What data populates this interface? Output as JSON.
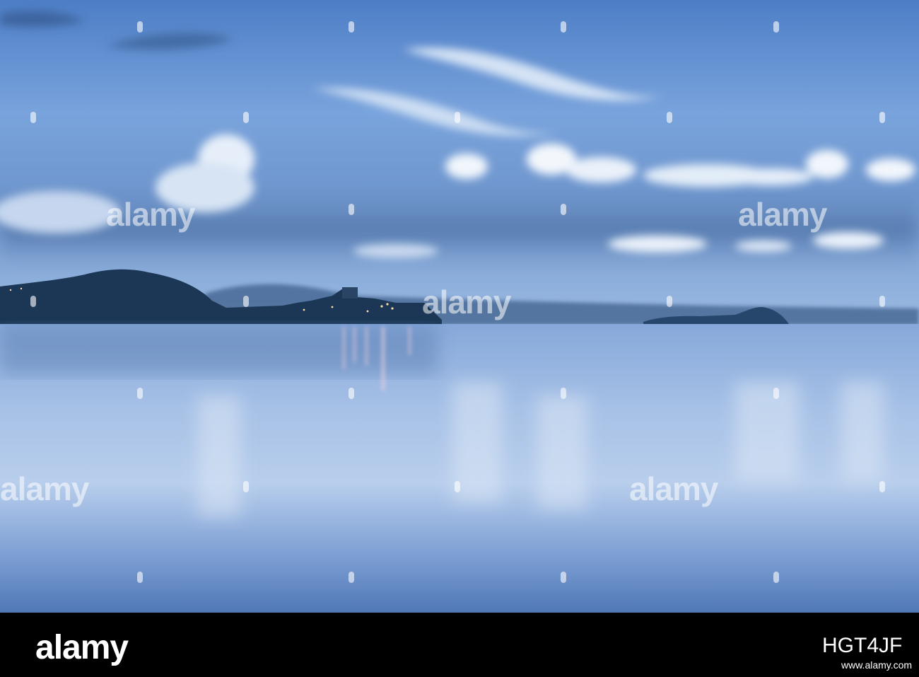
{
  "photo": {
    "subject": "lake-at-dusk",
    "colors": {
      "sky_top": "#4f7fc4",
      "sky_mid": "#8fb3e0",
      "cloud_band": "#5a7fb2",
      "hill_dark": "#1c3756",
      "water_top": "#7fa3d6",
      "water_bottom": "#3f6aa6"
    }
  },
  "watermark": {
    "text": "alamy"
  },
  "footer": {
    "logo": "alamy",
    "image_id": "HGT4JF",
    "url": "www.alamy.com"
  }
}
